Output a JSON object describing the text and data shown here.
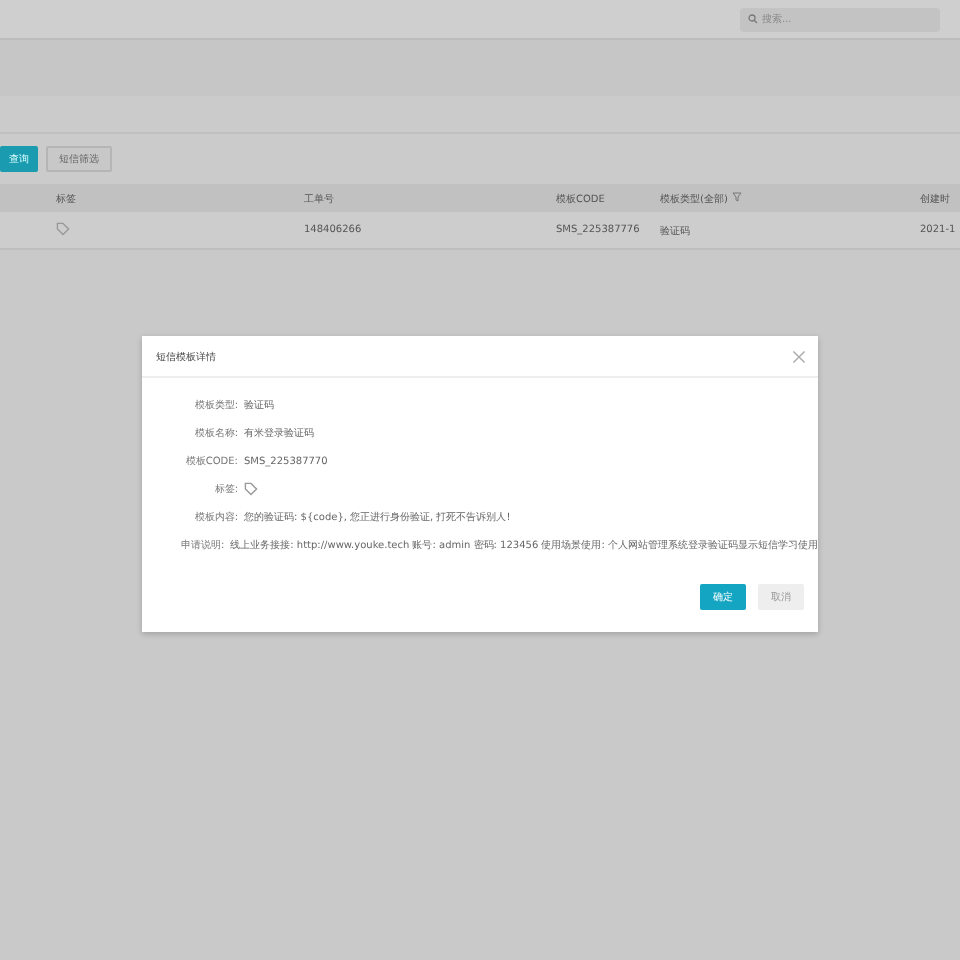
{
  "header": {
    "search": {
      "placeholder": "搜索..."
    }
  },
  "toolbar": {
    "buttons": [
      {
        "label": "查询",
        "kind": "primary"
      },
      {
        "label": "短信筛选",
        "kind": "default"
      }
    ]
  },
  "table": {
    "columns": [
      "标签",
      "工单号",
      "模板CODE",
      "模板类型(全部)",
      "创建时"
    ],
    "rows": [
      {
        "cells": [
          "",
          "148406266",
          "SMS_225387776",
          "验证码",
          "2021-1"
        ]
      }
    ]
  },
  "dialog": {
    "title": "短信模板详情",
    "fields": [
      {
        "label": "模板类型:",
        "value": "验证码",
        "kind": "text"
      },
      {
        "label": "模板名称:",
        "value": "有米登录验证码",
        "kind": "text"
      },
      {
        "label": "模板CODE:",
        "value": "SMS_225387770",
        "kind": "text"
      },
      {
        "label": "标签:",
        "kind": "tag"
      },
      {
        "label": "模板内容:",
        "value": "您的验证码: ${code}, 您正进行身份验证, 打死不告诉别人!",
        "kind": "text"
      },
      {
        "label": "申请说明:",
        "value": "线上业务接接: http://www.youke.tech 账号: admin 密码: 123456 使用场景使用: 个人网站管理系统登录验证码显示短信学习使用",
        "kind": "text"
      }
    ],
    "buttons": [
      {
        "label": "确定",
        "kind": "primary"
      },
      {
        "label": "取消",
        "kind": "default"
      }
    ]
  }
}
